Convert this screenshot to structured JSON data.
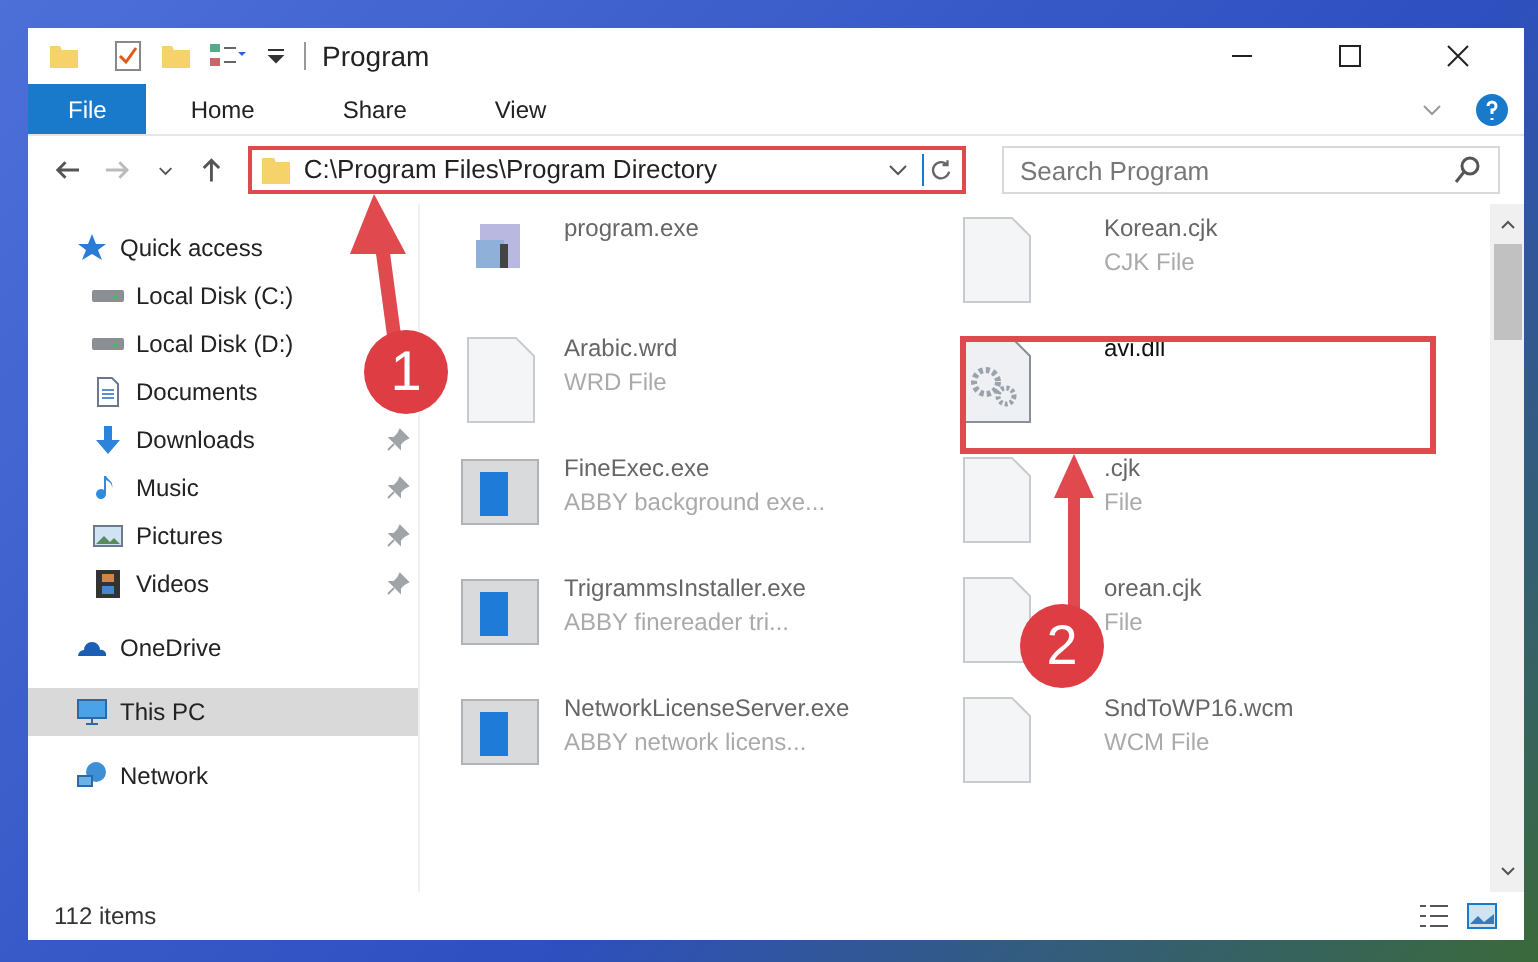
{
  "window": {
    "title": "Program"
  },
  "ribbon_tabs": [
    {
      "label": "File",
      "selected": true
    },
    {
      "label": "Home",
      "selected": false
    },
    {
      "label": "Share",
      "selected": false
    },
    {
      "label": "View",
      "selected": false
    }
  ],
  "address": {
    "path": "C:\\Program Files\\Program Directory"
  },
  "search": {
    "placeholder": "Search Program"
  },
  "sidebar": {
    "items": [
      {
        "label": "Quick access",
        "kind": "star",
        "pinned": false,
        "selected": false
      },
      {
        "label": "Local Disk (C:)",
        "kind": "drive",
        "pinned": false,
        "selected": false
      },
      {
        "label": "Local Disk (D:)",
        "kind": "drive",
        "pinned": false,
        "selected": false
      },
      {
        "label": "Documents",
        "kind": "documents",
        "pinned": false,
        "selected": false
      },
      {
        "label": "Downloads",
        "kind": "downloads",
        "pinned": true,
        "selected": false
      },
      {
        "label": "Music",
        "kind": "music",
        "pinned": true,
        "selected": false
      },
      {
        "label": "Pictures",
        "kind": "pictures",
        "pinned": true,
        "selected": false
      },
      {
        "label": "Videos",
        "kind": "videos",
        "pinned": true,
        "selected": false
      },
      {
        "label": "OneDrive",
        "kind": "cloud",
        "pinned": false,
        "selected": false
      },
      {
        "label": "This PC",
        "kind": "pc",
        "pinned": false,
        "selected": true
      },
      {
        "label": "Network",
        "kind": "network",
        "pinned": false,
        "selected": false
      }
    ]
  },
  "files": [
    {
      "name": "program.exe",
      "kind": "setup"
    },
    {
      "name": "Korean.cjk",
      "type": "CJK File",
      "kind": "blank"
    },
    {
      "name": "Arabic.wrd",
      "type": "WRD File",
      "kind": "blank"
    },
    {
      "name": "avi.dll",
      "kind": "dll"
    },
    {
      "name": "FineExec.exe",
      "type": "ABBY background exe...",
      "kind": "app"
    },
    {
      "name": ".cjk",
      "type": "File",
      "kind": "blank"
    },
    {
      "name": "TrigrammsInstaller.exe",
      "type": "ABBY finereader tri...",
      "kind": "app"
    },
    {
      "name": "orean.cjk",
      "type": "File",
      "kind": "blank"
    },
    {
      "name": "NetworkLicenseServer.exe",
      "type": "ABBY network licens...",
      "kind": "app"
    },
    {
      "name": "SndToWP16.wcm",
      "type": "WCM File",
      "kind": "blank"
    }
  ],
  "annotations": [
    {
      "label": "1"
    },
    {
      "label": "2"
    }
  ],
  "status_bar": {
    "count": "112 items"
  }
}
